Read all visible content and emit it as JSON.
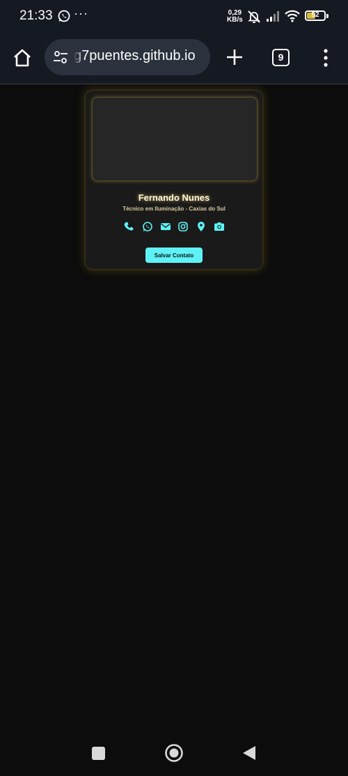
{
  "status_bar": {
    "time": "21:33",
    "more": "···",
    "net_speed_value": "0,29",
    "net_speed_unit": "KB/s",
    "battery": "52",
    "battery_level_percent": 52
  },
  "browser": {
    "url": "g7puentes.github.io",
    "tab_count": "9"
  },
  "card": {
    "name": "Fernando Nunes",
    "subtitle": "Técnico em Iluminação - Caxias do Sul",
    "icons": [
      "phone-icon",
      "whatsapp-icon",
      "email-icon",
      "instagram-icon",
      "location-icon",
      "camera-icon"
    ],
    "save_button": "Salvar Contato"
  },
  "colors": {
    "accent": "#5ef2f6",
    "glow": "#d2aa28",
    "background": "#0c0c0c",
    "card": "#1a1a1a",
    "toolbar": "#151922"
  }
}
